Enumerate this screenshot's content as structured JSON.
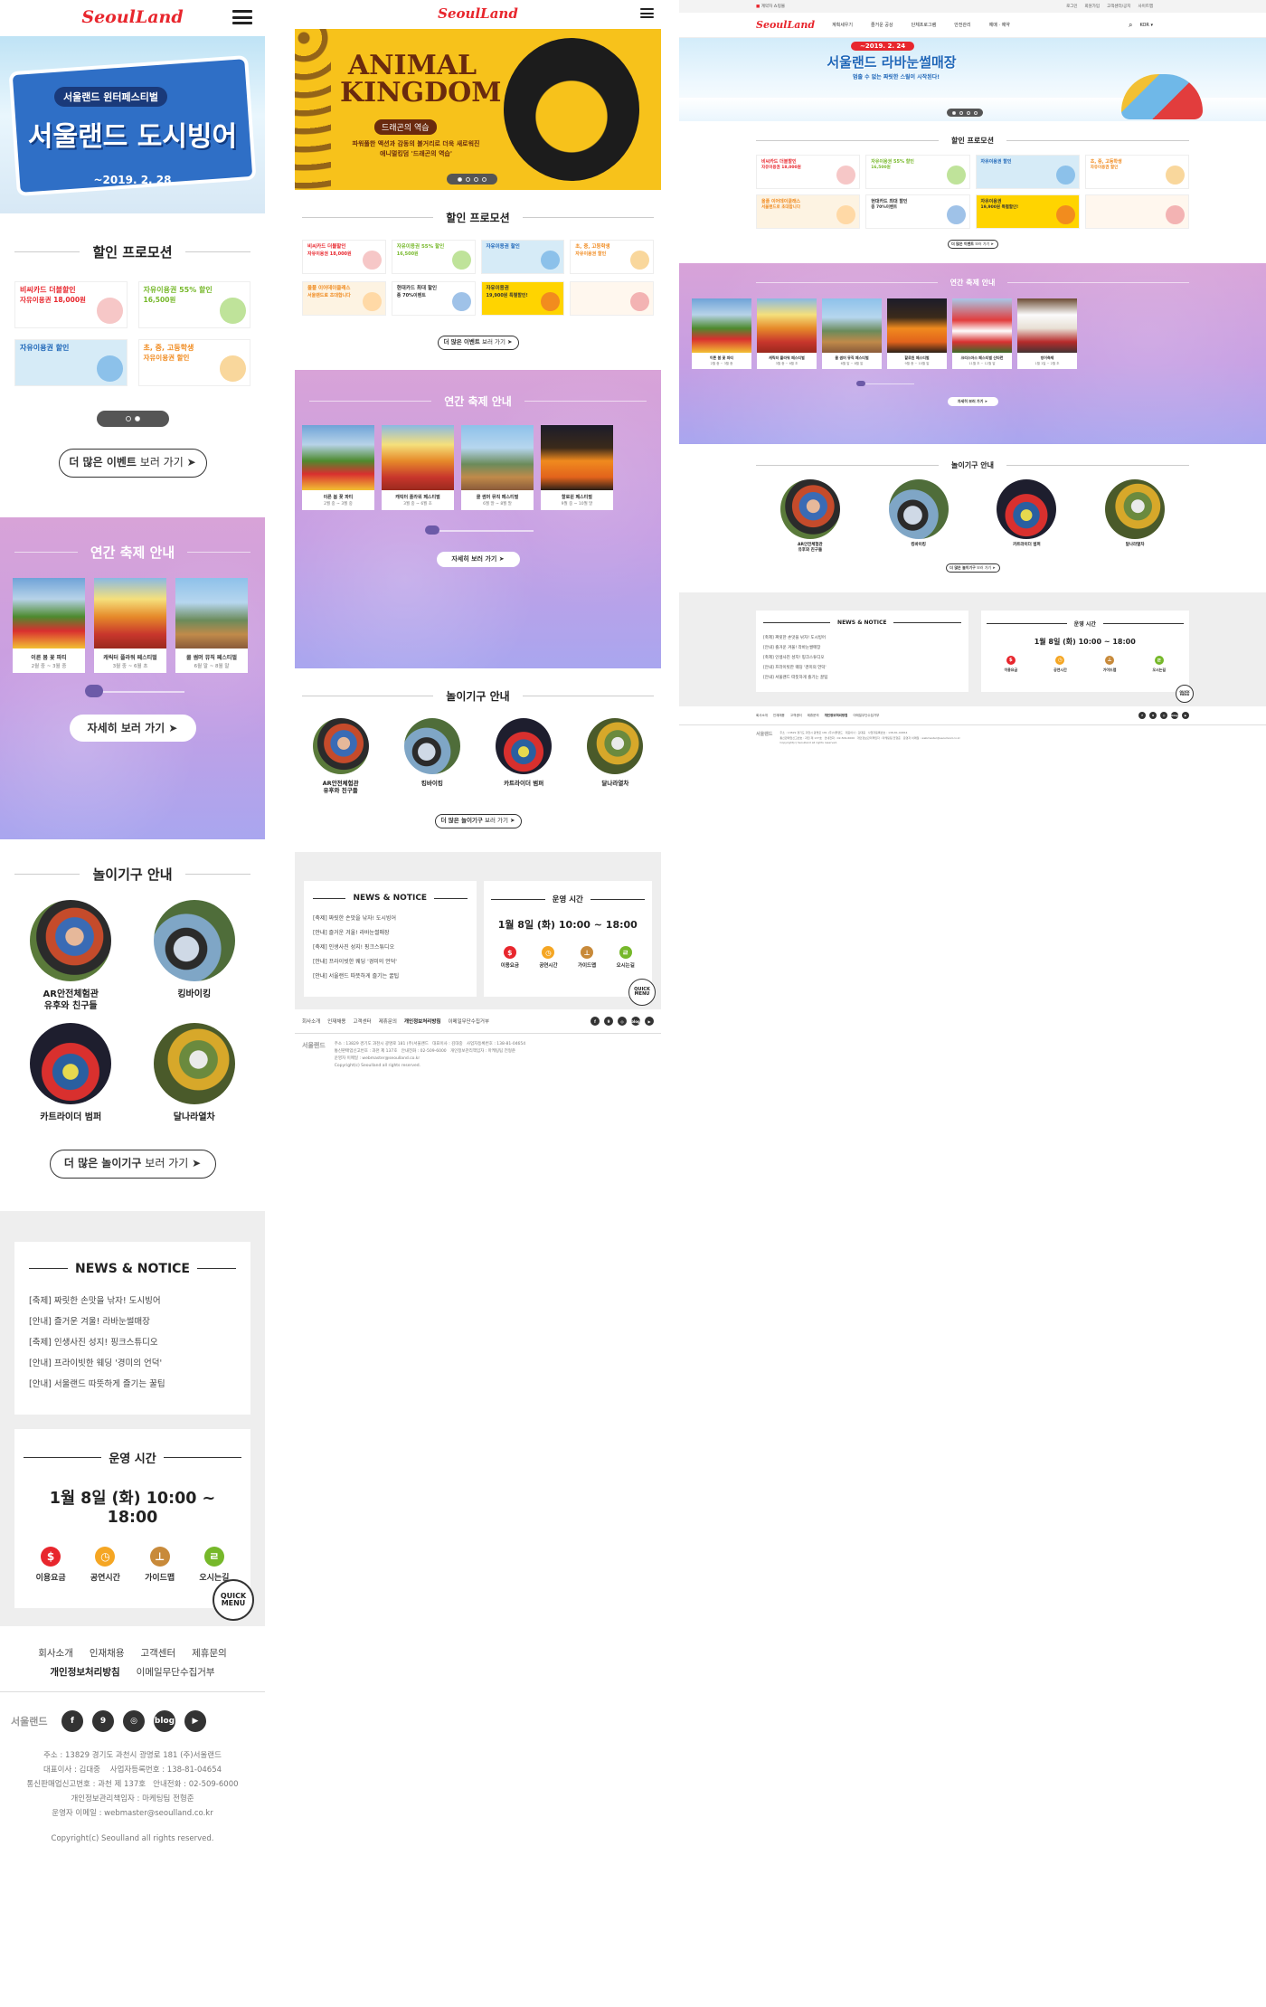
{
  "brand": {
    "logo": "SeoulLand",
    "color": "#e8262d"
  },
  "mobile": {
    "hero": {
      "badge": "서울랜드 윈터페스티벌",
      "title": "서울랜드 도시빙어",
      "date": "~2019. 2. 28"
    },
    "promotions": [
      {
        "title": "비씨카드 더블할인",
        "sub": "자유이용권 18,000원",
        "bg": "#ffffff",
        "color": "#e8262d"
      },
      {
        "title": "자유이용권 55% 할인",
        "sub": "16,500원",
        "bg": "#ffffff",
        "color": "#76b82a"
      },
      {
        "title": "자유이용권 할인",
        "sub": "",
        "bg": "#d6ebf7",
        "color": "#1e66b8"
      },
      {
        "title": "초, 중, 고등학생",
        "sub": "자유이용권 할인",
        "bg": "#ffffff",
        "color": "#f08a1e"
      }
    ]
  },
  "tablet": {
    "hero": {
      "title": "ANIMAL KINGDOM",
      "sub": "드래곤의 역습",
      "desc1": "파워풀한 액션과 감동의 볼거리로 더욱 새로워진",
      "desc2": "애니멀킹덤 '드래곤의 역습'"
    },
    "promotions": [
      {
        "title": "비씨카드 더블할인",
        "sub": "자유이용권 18,000원",
        "bg": "#ffffff",
        "color": "#e8262d"
      },
      {
        "title": "자유이용권 55% 할인",
        "sub": "16,500원",
        "bg": "#ffffff",
        "color": "#76b82a"
      },
      {
        "title": "자유이용권 할인",
        "sub": "",
        "bg": "#d6ebf7",
        "color": "#1e66b8"
      },
      {
        "title": "초, 중, 고등학생",
        "sub": "자유이용권 할인",
        "bg": "#ffffff",
        "color": "#f08a1e"
      },
      {
        "title": "올플 이어데이클래스",
        "sub": "서울랜드로 초대합니다",
        "bg": "#fdf3e2",
        "color": "#f08a1e"
      },
      {
        "title": "현대카드 최대 할인",
        "sub": "종 70%이벤트",
        "bg": "#ffffff",
        "color": "#333333"
      },
      {
        "title": "자유이용권",
        "sub": "19,900원 특별할인!",
        "bg": "#ffd400",
        "color": "#333333"
      },
      {
        "title": "",
        "sub": "",
        "bg": "#fff7ee",
        "color": "#e8262d"
      }
    ]
  },
  "desktop": {
    "topbar": {
      "left": "계약자 쇼핑몰",
      "links": [
        "로그인",
        "회원가입",
        "고객센터/공지",
        "사이트맵"
      ]
    },
    "gnb": [
      "계획세우기",
      "즐거운 공상",
      "단체프로그램",
      "안전관리",
      "예매 · 예약"
    ],
    "lang": "KOR",
    "hero": {
      "date": "~2019. 2. 24",
      "title": "서울랜드 라바눈썰매장",
      "sub": "멈출 수 없는 짜릿한 스릴이 시작된다!"
    },
    "promotions": [
      {
        "title": "비씨카드 더블할인",
        "sub": "자유이용권 18,000원",
        "bg": "#ffffff",
        "color": "#e8262d"
      },
      {
        "title": "자유이용권 55% 할인",
        "sub": "16,500원",
        "bg": "#ffffff",
        "color": "#76b82a"
      },
      {
        "title": "자유이용권 할인",
        "sub": "",
        "bg": "#d6ebf7",
        "color": "#1e66b8"
      },
      {
        "title": "초, 중, 고등학생",
        "sub": "자유이용권 할인",
        "bg": "#ffffff",
        "color": "#f08a1e"
      },
      {
        "title": "올플 이어데이클래스",
        "sub": "서울랜드로 초대합니다",
        "bg": "#fdf3e2",
        "color": "#f08a1e"
      },
      {
        "title": "현대카드 최대 할인",
        "sub": "종 70%이벤트",
        "bg": "#ffffff",
        "color": "#333333"
      },
      {
        "title": "자유이용권",
        "sub": "19,900원 특별할인!",
        "bg": "#ffd400",
        "color": "#333333"
      },
      {
        "title": "",
        "sub": "",
        "bg": "#fff7ee",
        "color": "#e8262d"
      }
    ]
  },
  "sections": {
    "promo_title": "할인 프로모션",
    "fest_title": "연간 축제 안내",
    "rides_title": "놀이기구 안내",
    "more_events_bold": "더 많은 이벤트",
    "more_rides_bold": "더 많은 놀이기구",
    "more_suffix": "보러 가기",
    "detail": "자세히 보러 가기",
    "arrow": "➤"
  },
  "festivals": [
    {
      "name": "이른 봄 꽃 파티",
      "date": "2월 중 ~ 3월 중"
    },
    {
      "name": "캐릭터 플라워 페스티벌",
      "date": "3월 중 ~ 6월 초"
    },
    {
      "name": "쿨 썸머 뮤직 페스티벌",
      "date": "6월 말 ~ 8월 말"
    },
    {
      "name": "할로윈 페스티벌",
      "date": "9월 중 ~ 10월 말"
    },
    {
      "name": "크리스마스 페스티벌 산타런",
      "date": "11월 초 ~ 12월 말"
    },
    {
      "name": "빙어축제",
      "date": "1월 1일 ~ 2월 초"
    }
  ],
  "rides": [
    {
      "name1": "AR안전체험관",
      "name2": "유후와 친구들"
    },
    {
      "name1": "킹바이킹",
      "name2": ""
    },
    {
      "name1": "카트라이더 범퍼",
      "name2": ""
    },
    {
      "name1": "달나라열차",
      "name2": ""
    }
  ],
  "news": {
    "title": "NEWS & NOTICE",
    "items": [
      "[축제] 짜릿한 손맛을 낚자! 도시빙어",
      "[안내] 즐거운 겨울! 라바눈썰매장",
      "[축제] 인생사진 성지! 핑크스튜디오",
      "[안내] 프라이빗한 웨딩 '경미의 언덕'",
      "[안내] 서울랜드 따뜻하게 즐기는 꿀팁"
    ]
  },
  "hours": {
    "title": "운영 시간",
    "time": "1월 8일 (화) 10:00 ~ 18:00",
    "icons": [
      {
        "label": "이용요금",
        "glyph": "$",
        "color": "#e8262d"
      },
      {
        "label": "공연시간",
        "glyph": "◷",
        "color": "#f5a623"
      },
      {
        "label": "가이드맵",
        "glyph": "⊥",
        "color": "#c88a3a"
      },
      {
        "label": "오시는길",
        "glyph": "ㄹ",
        "color": "#76b82a"
      }
    ]
  },
  "quick": {
    "line1": "QUICK",
    "line2": "MENU"
  },
  "footer": {
    "links": [
      "회사소개",
      "인재채용",
      "고객센터",
      "제휴문의",
      "개인정보처리방침",
      "이메일무단수집거부"
    ],
    "sns": [
      "f",
      "9",
      "◎",
      "blog",
      "▶"
    ],
    "logo": "서울랜드",
    "addr": "주소 : 13829 경기도 과천시 광명로 181 (주)서울랜드",
    "ceo": "대표이사 : 김대중",
    "biz": "사업자등록번호 : 138-81-04654",
    "mail_order": "통신판매업신고번호 : 과천 제 137호",
    "tel": "안내전화 : 02-509-6000",
    "privacy": "개인정보관리책임자 : 마케팅팀 전형준",
    "email": "운영자 이메일 : webmaster@seoulland.co.kr",
    "copyright": "Copyright(c) Seoulland all rights reserved."
  }
}
